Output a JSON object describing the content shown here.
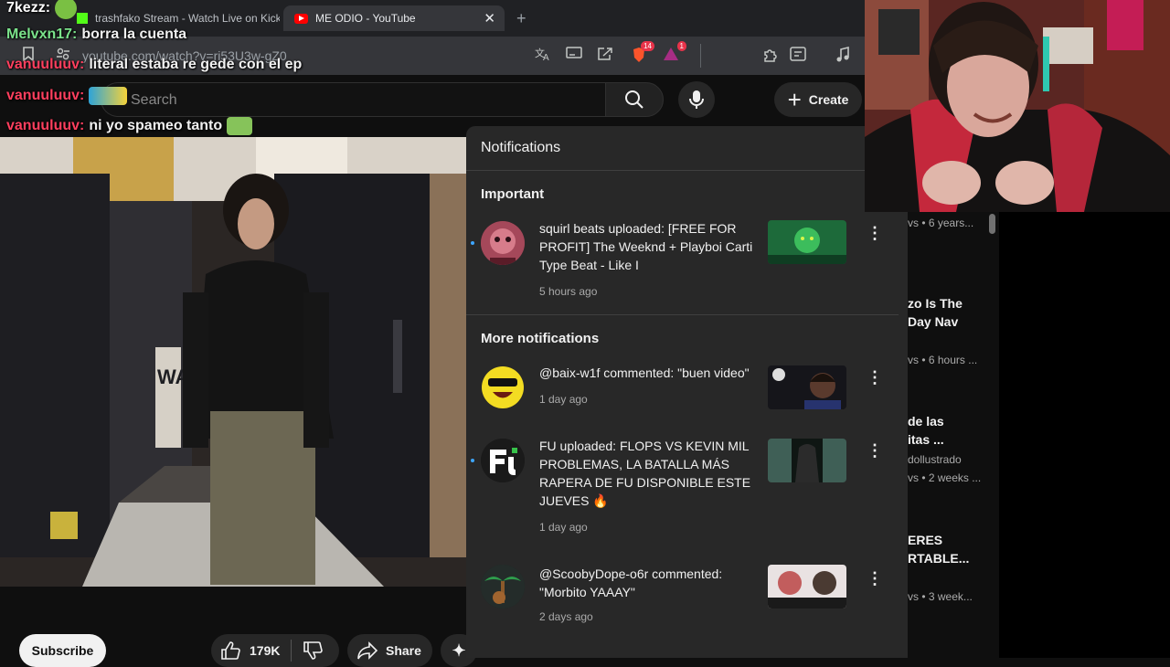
{
  "browser": {
    "tabs": [
      {
        "title": "trashfako Stream - Watch Live on Kick",
        "active": false
      },
      {
        "title": "ME ODIO - YouTube",
        "active": true
      }
    ],
    "url": "youtube.com/watch?v=ri53U3w-gZ0",
    "extension_badges": {
      "brave": "14",
      "rewards": "1"
    }
  },
  "youtube": {
    "search_placeholder": "Search",
    "create_label": "Create",
    "subscribe_label": "Subscribe",
    "like_count": "179K",
    "share_label": "Share"
  },
  "chat": [
    {
      "user": "7kezz:",
      "message": "",
      "user_color": "#ffffff"
    },
    {
      "user": "Melvxn17:",
      "message": "borra la cuenta",
      "user_color": "#7be38b"
    },
    {
      "user": "vanuuluuv:",
      "message": "literal estaba re gede con el ep",
      "user_color": "#ff3f5e"
    },
    {
      "user": "vanuuluuv:",
      "message": "",
      "user_color": "#ff3f5e"
    },
    {
      "user": "vanuuluuv:",
      "message": "ni yo spameo tanto",
      "user_color": "#ff3f5e"
    }
  ],
  "notifications": {
    "title": "Notifications",
    "important_label": "Important",
    "more_label": "More notifications",
    "items": [
      {
        "text": "squirl beats uploaded: [FREE FOR PROFIT] The Weeknd + Playboi Carti Type Beat - Like I",
        "time": "5 hours ago",
        "unread": true
      },
      {
        "text": "@baix-w1f commented: \"buen video\"",
        "time": "1 day ago",
        "unread": false
      },
      {
        "text": "FU uploaded: FLOPS VS KEVIN MIL PROBLEMAS, LA BATALLA MÁS RAPERA DE FU DISPONIBLE ESTE JUEVES 🔥",
        "time": "1 day ago",
        "unread": true
      },
      {
        "text": "@ScoobyDope-o6r commented: \"Morbito YAAAY\"",
        "time": "2 days ago",
        "unread": false
      }
    ]
  },
  "recommendations": [
    {
      "meta": "vs • 6 years..."
    },
    {
      "title1": "zo Is The",
      "title2": "Day Nav",
      "meta": "vs • 6 hours ..."
    },
    {
      "title1": "de las",
      "title2": "itas ...",
      "channel": "dollustrado",
      "meta": "vs • 2 weeks ..."
    },
    {
      "title1": "ERES",
      "title2": "RTABLE...",
      "meta": "vs • 3 week..."
    }
  ],
  "colors": {
    "background": "#0f0f0f",
    "panel": "#282828",
    "youtube_red": "#ff0000",
    "unread_dot": "#3ea6ff"
  }
}
